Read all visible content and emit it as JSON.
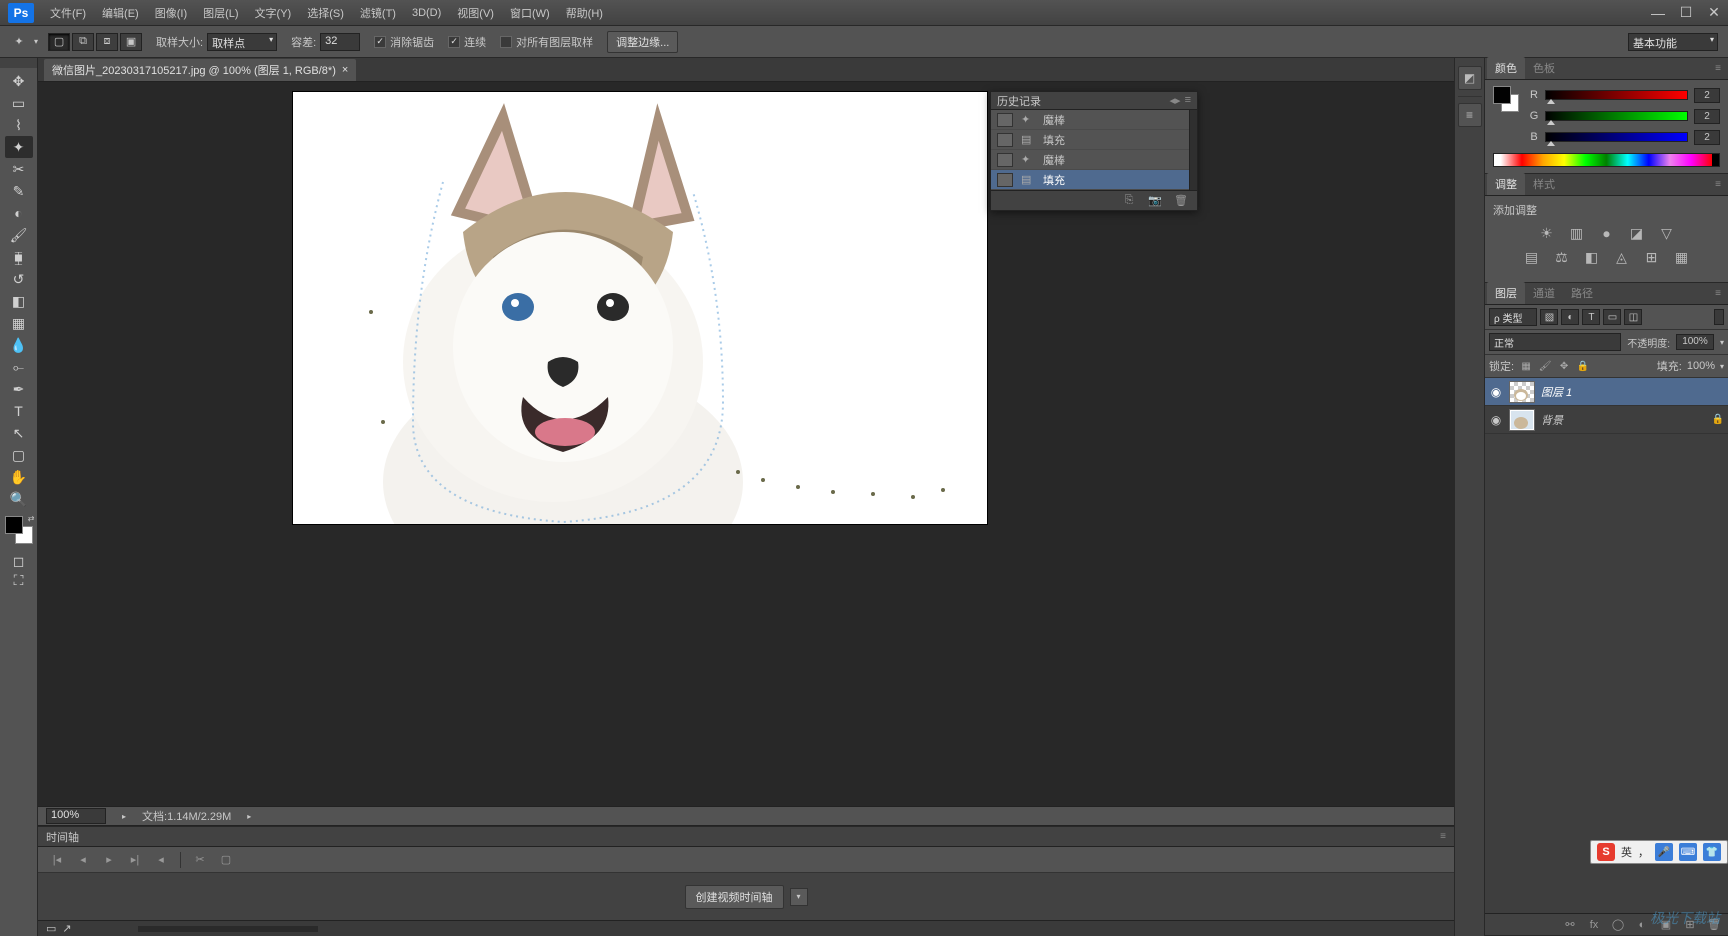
{
  "app": {
    "logo": "Ps"
  },
  "menu": [
    "文件(F)",
    "编辑(E)",
    "图像(I)",
    "图层(L)",
    "文字(Y)",
    "选择(S)",
    "滤镜(T)",
    "3D(D)",
    "视图(V)",
    "窗口(W)",
    "帮助(H)"
  ],
  "window_controls": {
    "min": "—",
    "max": "☐",
    "close": "✕"
  },
  "options_bar": {
    "sample_size_label": "取样大小:",
    "sample_size_value": "取样点",
    "tolerance_label": "容差:",
    "tolerance_value": "32",
    "antialias_label": "消除锯齿",
    "antialias_checked": true,
    "contiguous_label": "连续",
    "contiguous_checked": true,
    "all_layers_label": "对所有图层取样",
    "all_layers_checked": false,
    "refine_edge": "调整边缘...",
    "workspace_switch": "基本功能"
  },
  "doc_tab": {
    "title": "微信图片_20230317105217.jpg @ 100% (图层 1, RGB/8*)",
    "close": "×"
  },
  "status": {
    "zoom": "100%",
    "doc_label": "文档:",
    "doc_size": "1.14M/2.29M"
  },
  "timeline": {
    "title": "时间轴",
    "create_btn": "创建视频时间轴"
  },
  "history": {
    "title": "历史记录",
    "items": [
      {
        "icon": "✦",
        "label": "魔棒",
        "selected": false
      },
      {
        "icon": "▤",
        "label": "填充",
        "selected": false
      },
      {
        "icon": "✦",
        "label": "魔棒",
        "selected": false
      },
      {
        "icon": "▤",
        "label": "填充",
        "selected": true
      }
    ]
  },
  "color_panel": {
    "tabs": [
      "颜色",
      "色板"
    ],
    "channels": [
      {
        "label": "R",
        "value": "2",
        "slider": "slider-r"
      },
      {
        "label": "G",
        "value": "2",
        "slider": "slider-g"
      },
      {
        "label": "B",
        "value": "2",
        "slider": "slider-b"
      }
    ]
  },
  "adjustments_panel": {
    "tabs": [
      "调整",
      "样式"
    ],
    "add_label": "添加调整"
  },
  "layers_panel": {
    "tabs": [
      "图层",
      "通道",
      "路径"
    ],
    "filter_kind": "ρ 类型",
    "blend_mode": "正常",
    "opacity_label": "不透明度:",
    "opacity_value": "100%",
    "lock_label": "锁定:",
    "fill_label": "填充:",
    "fill_value": "100%",
    "layers": [
      {
        "name": "图层 1",
        "selected": true,
        "locked": false,
        "thumb": "dog"
      },
      {
        "name": "背景",
        "selected": false,
        "locked": true,
        "thumb": "dog"
      }
    ]
  },
  "footer_bar": {
    "mini": "▭",
    "arrow": "↗"
  },
  "ime": {
    "logo": "S",
    "lang": "英",
    "comma": "，"
  }
}
